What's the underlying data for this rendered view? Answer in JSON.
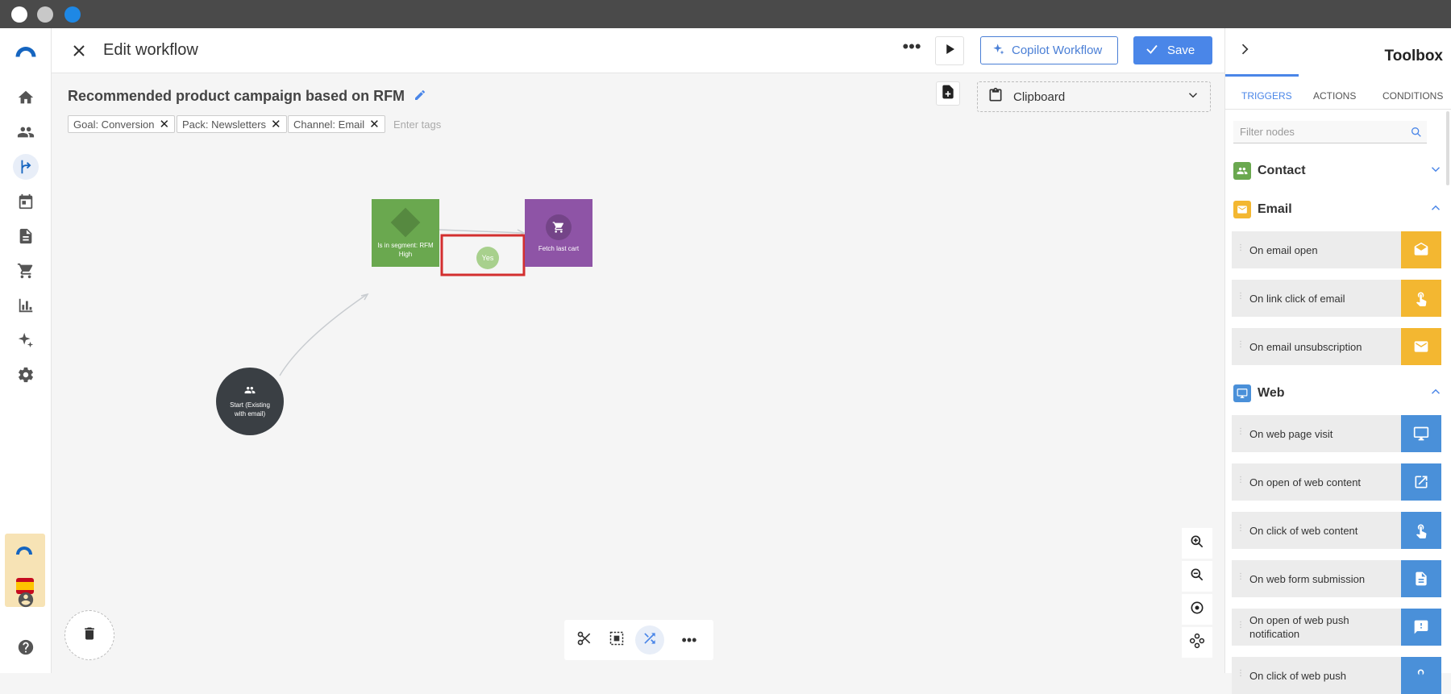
{
  "header": {
    "title": "Edit workflow",
    "copilot_label": "Copilot Workflow",
    "save_label": "Save"
  },
  "campaign": {
    "title": "Recommended product campaign based on RFM",
    "tags": [
      "Goal: Conversion",
      "Pack: Newsletters",
      "Channel: Email"
    ],
    "tags_placeholder": "Enter tags",
    "clipboard_label": "Clipboard"
  },
  "nodes": {
    "segment_label": "Is in segment: RFM High",
    "edge_label": "Yes",
    "fetch_label": "Fetch last cart",
    "start_label": "Start (Existing with email)"
  },
  "toolbox": {
    "title": "Toolbox",
    "tabs": [
      "TRIGGERS",
      "ACTIONS",
      "CONDITIONS"
    ],
    "filter_placeholder": "Filter nodes",
    "sections": {
      "contact": "Contact",
      "email": "Email",
      "web": "Web"
    },
    "email_items": [
      "On email open",
      "On link click of email",
      "On email unsubscription"
    ],
    "web_items": [
      "On web page visit",
      "On open of web content",
      "On click of web content",
      "On web form submission",
      "On open of web push notification",
      "On click of web push"
    ]
  },
  "colors": {
    "accent": "#4a86e8",
    "segment_node": "#6aa84f",
    "fetch_node": "#8e54a6",
    "start_node": "#3a3f44",
    "email_yellow": "#f3b731",
    "web_blue": "#4a90d9",
    "contact_green": "#6aa84f",
    "highlight": "#d32f2f"
  }
}
